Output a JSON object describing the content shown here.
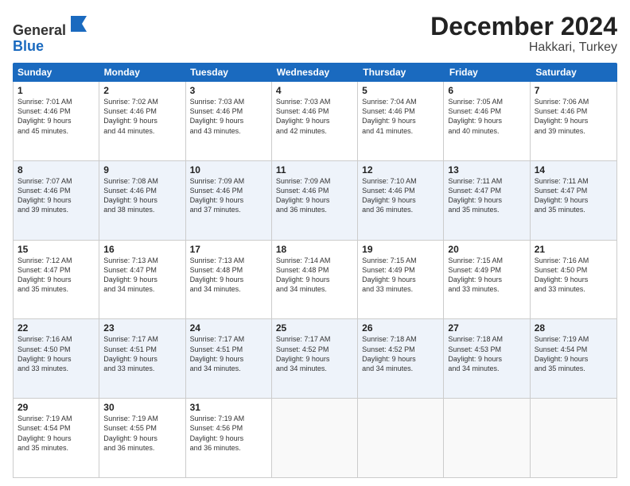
{
  "logo": {
    "general": "General",
    "blue": "Blue"
  },
  "header": {
    "month": "December 2024",
    "location": "Hakkari, Turkey"
  },
  "days": [
    "Sunday",
    "Monday",
    "Tuesday",
    "Wednesday",
    "Thursday",
    "Friday",
    "Saturday"
  ],
  "rows": [
    [
      {
        "day": "1",
        "lines": [
          "Sunrise: 7:01 AM",
          "Sunset: 4:46 PM",
          "Daylight: 9 hours",
          "and 45 minutes."
        ]
      },
      {
        "day": "2",
        "lines": [
          "Sunrise: 7:02 AM",
          "Sunset: 4:46 PM",
          "Daylight: 9 hours",
          "and 44 minutes."
        ]
      },
      {
        "day": "3",
        "lines": [
          "Sunrise: 7:03 AM",
          "Sunset: 4:46 PM",
          "Daylight: 9 hours",
          "and 43 minutes."
        ]
      },
      {
        "day": "4",
        "lines": [
          "Sunrise: 7:03 AM",
          "Sunset: 4:46 PM",
          "Daylight: 9 hours",
          "and 42 minutes."
        ]
      },
      {
        "day": "5",
        "lines": [
          "Sunrise: 7:04 AM",
          "Sunset: 4:46 PM",
          "Daylight: 9 hours",
          "and 41 minutes."
        ]
      },
      {
        "day": "6",
        "lines": [
          "Sunrise: 7:05 AM",
          "Sunset: 4:46 PM",
          "Daylight: 9 hours",
          "and 40 minutes."
        ]
      },
      {
        "day": "7",
        "lines": [
          "Sunrise: 7:06 AM",
          "Sunset: 4:46 PM",
          "Daylight: 9 hours",
          "and 39 minutes."
        ]
      }
    ],
    [
      {
        "day": "8",
        "lines": [
          "Sunrise: 7:07 AM",
          "Sunset: 4:46 PM",
          "Daylight: 9 hours",
          "and 39 minutes."
        ]
      },
      {
        "day": "9",
        "lines": [
          "Sunrise: 7:08 AM",
          "Sunset: 4:46 PM",
          "Daylight: 9 hours",
          "and 38 minutes."
        ]
      },
      {
        "day": "10",
        "lines": [
          "Sunrise: 7:09 AM",
          "Sunset: 4:46 PM",
          "Daylight: 9 hours",
          "and 37 minutes."
        ]
      },
      {
        "day": "11",
        "lines": [
          "Sunrise: 7:09 AM",
          "Sunset: 4:46 PM",
          "Daylight: 9 hours",
          "and 36 minutes."
        ]
      },
      {
        "day": "12",
        "lines": [
          "Sunrise: 7:10 AM",
          "Sunset: 4:46 PM",
          "Daylight: 9 hours",
          "and 36 minutes."
        ]
      },
      {
        "day": "13",
        "lines": [
          "Sunrise: 7:11 AM",
          "Sunset: 4:47 PM",
          "Daylight: 9 hours",
          "and 35 minutes."
        ]
      },
      {
        "day": "14",
        "lines": [
          "Sunrise: 7:11 AM",
          "Sunset: 4:47 PM",
          "Daylight: 9 hours",
          "and 35 minutes."
        ]
      }
    ],
    [
      {
        "day": "15",
        "lines": [
          "Sunrise: 7:12 AM",
          "Sunset: 4:47 PM",
          "Daylight: 9 hours",
          "and 35 minutes."
        ]
      },
      {
        "day": "16",
        "lines": [
          "Sunrise: 7:13 AM",
          "Sunset: 4:47 PM",
          "Daylight: 9 hours",
          "and 34 minutes."
        ]
      },
      {
        "day": "17",
        "lines": [
          "Sunrise: 7:13 AM",
          "Sunset: 4:48 PM",
          "Daylight: 9 hours",
          "and 34 minutes."
        ]
      },
      {
        "day": "18",
        "lines": [
          "Sunrise: 7:14 AM",
          "Sunset: 4:48 PM",
          "Daylight: 9 hours",
          "and 34 minutes."
        ]
      },
      {
        "day": "19",
        "lines": [
          "Sunrise: 7:15 AM",
          "Sunset: 4:49 PM",
          "Daylight: 9 hours",
          "and 33 minutes."
        ]
      },
      {
        "day": "20",
        "lines": [
          "Sunrise: 7:15 AM",
          "Sunset: 4:49 PM",
          "Daylight: 9 hours",
          "and 33 minutes."
        ]
      },
      {
        "day": "21",
        "lines": [
          "Sunrise: 7:16 AM",
          "Sunset: 4:50 PM",
          "Daylight: 9 hours",
          "and 33 minutes."
        ]
      }
    ],
    [
      {
        "day": "22",
        "lines": [
          "Sunrise: 7:16 AM",
          "Sunset: 4:50 PM",
          "Daylight: 9 hours",
          "and 33 minutes."
        ]
      },
      {
        "day": "23",
        "lines": [
          "Sunrise: 7:17 AM",
          "Sunset: 4:51 PM",
          "Daylight: 9 hours",
          "and 33 minutes."
        ]
      },
      {
        "day": "24",
        "lines": [
          "Sunrise: 7:17 AM",
          "Sunset: 4:51 PM",
          "Daylight: 9 hours",
          "and 34 minutes."
        ]
      },
      {
        "day": "25",
        "lines": [
          "Sunrise: 7:17 AM",
          "Sunset: 4:52 PM",
          "Daylight: 9 hours",
          "and 34 minutes."
        ]
      },
      {
        "day": "26",
        "lines": [
          "Sunrise: 7:18 AM",
          "Sunset: 4:52 PM",
          "Daylight: 9 hours",
          "and 34 minutes."
        ]
      },
      {
        "day": "27",
        "lines": [
          "Sunrise: 7:18 AM",
          "Sunset: 4:53 PM",
          "Daylight: 9 hours",
          "and 34 minutes."
        ]
      },
      {
        "day": "28",
        "lines": [
          "Sunrise: 7:19 AM",
          "Sunset: 4:54 PM",
          "Daylight: 9 hours",
          "and 35 minutes."
        ]
      }
    ],
    [
      {
        "day": "29",
        "lines": [
          "Sunrise: 7:19 AM",
          "Sunset: 4:54 PM",
          "Daylight: 9 hours",
          "and 35 minutes."
        ]
      },
      {
        "day": "30",
        "lines": [
          "Sunrise: 7:19 AM",
          "Sunset: 4:55 PM",
          "Daylight: 9 hours",
          "and 36 minutes."
        ]
      },
      {
        "day": "31",
        "lines": [
          "Sunrise: 7:19 AM",
          "Sunset: 4:56 PM",
          "Daylight: 9 hours",
          "and 36 minutes."
        ]
      },
      null,
      null,
      null,
      null
    ]
  ]
}
